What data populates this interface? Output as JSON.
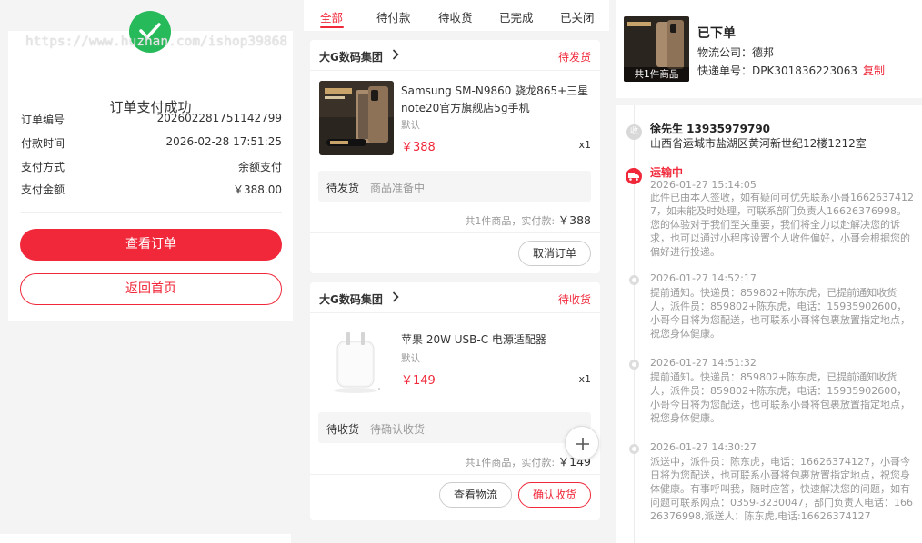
{
  "colors": {
    "accent": "#f0283a",
    "success": "#27ba5a"
  },
  "payment": {
    "watermark": "https://www.huzhan.com/ishop39868",
    "title": "订单支付成功",
    "rows": [
      {
        "label": "订单编号",
        "value": "202602281751142799"
      },
      {
        "label": "付款时间",
        "value": "2026-02-28 17:51:25"
      },
      {
        "label": "支付方式",
        "value": "余额支付"
      },
      {
        "label": "支付金额",
        "value": "￥388.00"
      }
    ],
    "view_order_label": "查看订单",
    "home_label": "返回首页",
    "icon": "check-circle-icon"
  },
  "orders": {
    "tabs": [
      "全部",
      "待付款",
      "待收货",
      "已完成",
      "已关闭"
    ],
    "active_tab": 0,
    "list": [
      {
        "shop": "大G数码集团",
        "status": "待发货",
        "product_name": "Samsung SM-N9860 骁龙865+三星note20官方旗舰店5g手机",
        "spec": "默认",
        "price": "￥388",
        "qty": "x1",
        "ship_status": "待发货",
        "ship_note": "商品准备中",
        "summary_prefix": "共1件商品，实付款: ",
        "summary_amount": "￥388",
        "buttons": [
          "取消订单"
        ]
      },
      {
        "shop": "大G数码集团",
        "status": "待收货",
        "product_name": "苹果 20W USB-C 电源适配器",
        "spec": "默认",
        "price": "￥149",
        "qty": "x1",
        "ship_status": "待收货",
        "ship_note": "待确认收货",
        "summary_prefix": "共1件商品，实付款: ",
        "summary_amount": "￥149",
        "buttons": [
          "查看物流",
          "确认收货"
        ]
      }
    ],
    "fab_icon": "plus-icon"
  },
  "logistics": {
    "thumb_caption": "共1件商品",
    "status": "已下单",
    "company_label": "物流公司：",
    "company": "德邦",
    "tracking_label": "快递单号：",
    "tracking_no": "DPK301836223063",
    "copy_label": "复制",
    "receiver": "徐先生 13935979790",
    "address": "山西省运城市盐湖区黄河新世纪12楼1212室",
    "receiver_badge": "收",
    "events": [
      {
        "title": "运输中",
        "time": "2026-01-27 15:14:05",
        "text": "此件已由本人签收，如有疑问可优先联系小哥16626374127，如未能及时处理，可联系部门负责人16626376998。您的体验对于我们至关重要，我们将全力以赴解决您的诉求，也可以通过小程序设置个人收件偏好，小哥会根据您的偏好进行投递。"
      },
      {
        "title": "",
        "time": "2026-01-27 14:52:17",
        "text": "提前通知。快递员：859802+陈东虎，已提前通知收货人，派件员：859802+陈东虎，电话：15935902600，小哥今日将为您配送，也可联系小哥将包裹放置指定地点，祝您身体健康。"
      },
      {
        "title": "",
        "time": "2026-01-27 14:51:32",
        "text": "提前通知。快递员：859802+陈东虎，已提前通知收货人，派件员：859802+陈东虎，电话：15935902600，小哥今日将为您配送，也可联系小哥将包裹放置指定地点，祝您身体健康。"
      },
      {
        "title": "",
        "time": "2026-01-27 14:30:27",
        "text": "派送中，派件员：陈东虎，电话：16626374127，小哥今日将为您配送，也可联系小哥将包裹放置指定地点，祝您身体健康。有事呼叫我，随时应答，快速解决您的问题，如有问题可联系网点：0359-3230047，部门负责人电话：16626376998,派送人：陈东虎,电话:16626374127"
      }
    ]
  }
}
